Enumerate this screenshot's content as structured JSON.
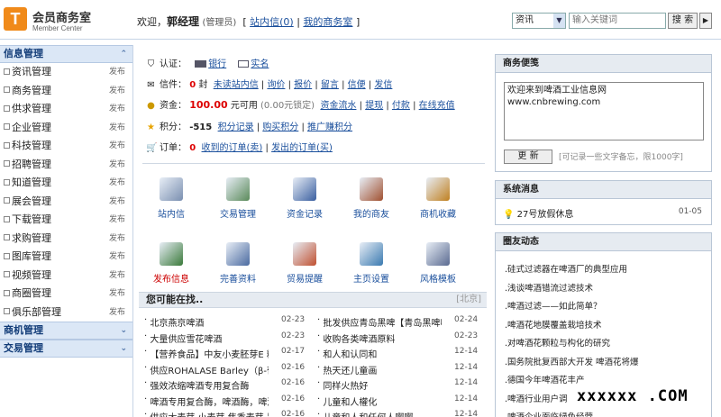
{
  "header": {
    "logo_mark": "T",
    "logo_title": "会员商务室",
    "logo_sub": "Member Center",
    "welcome": "欢迎，",
    "username": "郭经理",
    "role": "(管理员)",
    "link_inbox": "站内信(0)",
    "sep": "|",
    "link_office": "我的商务室",
    "bracket_open": "[",
    "bracket_close": "]",
    "search_select": "资讯",
    "search_placeholder": "输入关键词",
    "search_button": "搜 索",
    "go_arrow": "▶"
  },
  "sidebar": {
    "section1": "信息管理",
    "items": [
      {
        "label": "资讯管理",
        "action": "发布"
      },
      {
        "label": "商务管理",
        "action": "发布"
      },
      {
        "label": "供求管理",
        "action": "发布"
      },
      {
        "label": "企业管理",
        "action": "发布"
      },
      {
        "label": "科技管理",
        "action": "发布"
      },
      {
        "label": "招聘管理",
        "action": "发布"
      },
      {
        "label": "知道管理",
        "action": "发布"
      },
      {
        "label": "展会管理",
        "action": "发布"
      },
      {
        "label": "下载管理",
        "action": "发布"
      },
      {
        "label": "求购管理",
        "action": "发布"
      },
      {
        "label": "图库管理",
        "action": "发布"
      },
      {
        "label": "视频管理",
        "action": "发布"
      },
      {
        "label": "商圈管理",
        "action": "发布"
      },
      {
        "label": "俱乐部管理",
        "action": "发布"
      }
    ],
    "section2": "商机管理",
    "section3": "交易管理"
  },
  "account": {
    "auth_label": "认证：",
    "auth_bank": "银行",
    "auth_realname": "实名",
    "mail_label": "信件：",
    "mail_count": "0",
    "mail_unit": "封",
    "mail_links": [
      "未读站内信",
      "询价",
      "报价",
      "留言",
      "信便",
      "发信"
    ],
    "money_label": "资金：",
    "money_value": "100.00",
    "money_unit": "元可用",
    "money_locked": "(0.00元锁定)",
    "money_links": [
      "资金流水",
      "提现",
      "付款",
      "在线充值"
    ],
    "points_label": "积分：",
    "points_value": "-515",
    "points_links": [
      "积分记录",
      "购买积分",
      "推广赚积分"
    ],
    "order_label": "订单：",
    "order_count": "0",
    "order_links": [
      "收到的订单(卖)",
      "发出的订单(买)"
    ]
  },
  "tools": [
    {
      "label": "站内信"
    },
    {
      "label": "交易管理"
    },
    {
      "label": "资金记录"
    },
    {
      "label": "我的商友"
    },
    {
      "label": "商机收藏"
    },
    {
      "label": "发布信息"
    },
    {
      "label": "完善资料"
    },
    {
      "label": "贸易提醒"
    },
    {
      "label": "主页设置"
    },
    {
      "label": "风格模板"
    }
  ],
  "maybe": {
    "title": "您可能在找..",
    "tag": "[北京]",
    "left": [
      {
        "text": "北京燕京啤酒",
        "date": "02-23"
      },
      {
        "text": "大量供应雪花啤酒",
        "date": "02-23"
      },
      {
        "text": "【营养食品】中友小麦胚芽E 精",
        "date": "02-17"
      },
      {
        "text": "供应ROHALASE Barley（β-葡",
        "date": "02-16"
      },
      {
        "text": "强效浓缩啤酒专用复合酶",
        "date": "02-16"
      },
      {
        "text": "啤酒专用复合酶，啤酒酶，啤酒",
        "date": "02-16"
      },
      {
        "text": "供应大麦芽 小麦芽 焦香麦芽 黑",
        "date": "02-16"
      }
    ],
    "right": [
      {
        "text": "批发供应青岛黑啤【青岛黑啤啤",
        "date": "02-24"
      },
      {
        "text": "收购各类啤酒原料",
        "date": "02-23"
      },
      {
        "text": "和人和认同和",
        "date": "12-14"
      },
      {
        "text": "热天还儿童画",
        "date": "12-14"
      },
      {
        "text": "同样火热好",
        "date": "12-14"
      },
      {
        "text": "儿童和人權化",
        "date": "12-14"
      },
      {
        "text": "儿童和人和任何人啊啊",
        "date": "12-14"
      }
    ]
  },
  "memo": {
    "title": "商务便笺",
    "line1": "欢迎来到啤酒工业信息网",
    "line2": "www.cnbrewing.com",
    "button": "更 新",
    "tip": "[可记录一些文字备忘，限1000字]"
  },
  "sysmsg": {
    "title": "系统消息",
    "text": "27号放假休息",
    "date": "01-05"
  },
  "news": {
    "title": "圈友动态",
    "items": [
      ".硅式过滤器在啤酒厂的典型应用",
      ".浅谈啤酒错流过滤技术",
      ".啤酒过滤——如此简单？",
      ".啤酒花地膜覆盖栽培技术",
      ".对啤酒花颗粒与构化的研究",
      ".国务院批复西部大开发 啤酒花将爆",
      ".德国今年啤酒花丰产",
      ".啤酒行业用户调",
      ".啤酒企业面临绿色经营"
    ]
  },
  "watermark": "xxxxxx .COM",
  "colors": {
    "accent": "#1a4f9c",
    "logo": "#f08a1a",
    "sidebar_head": "#dbe7f6",
    "money": "#d00000"
  }
}
